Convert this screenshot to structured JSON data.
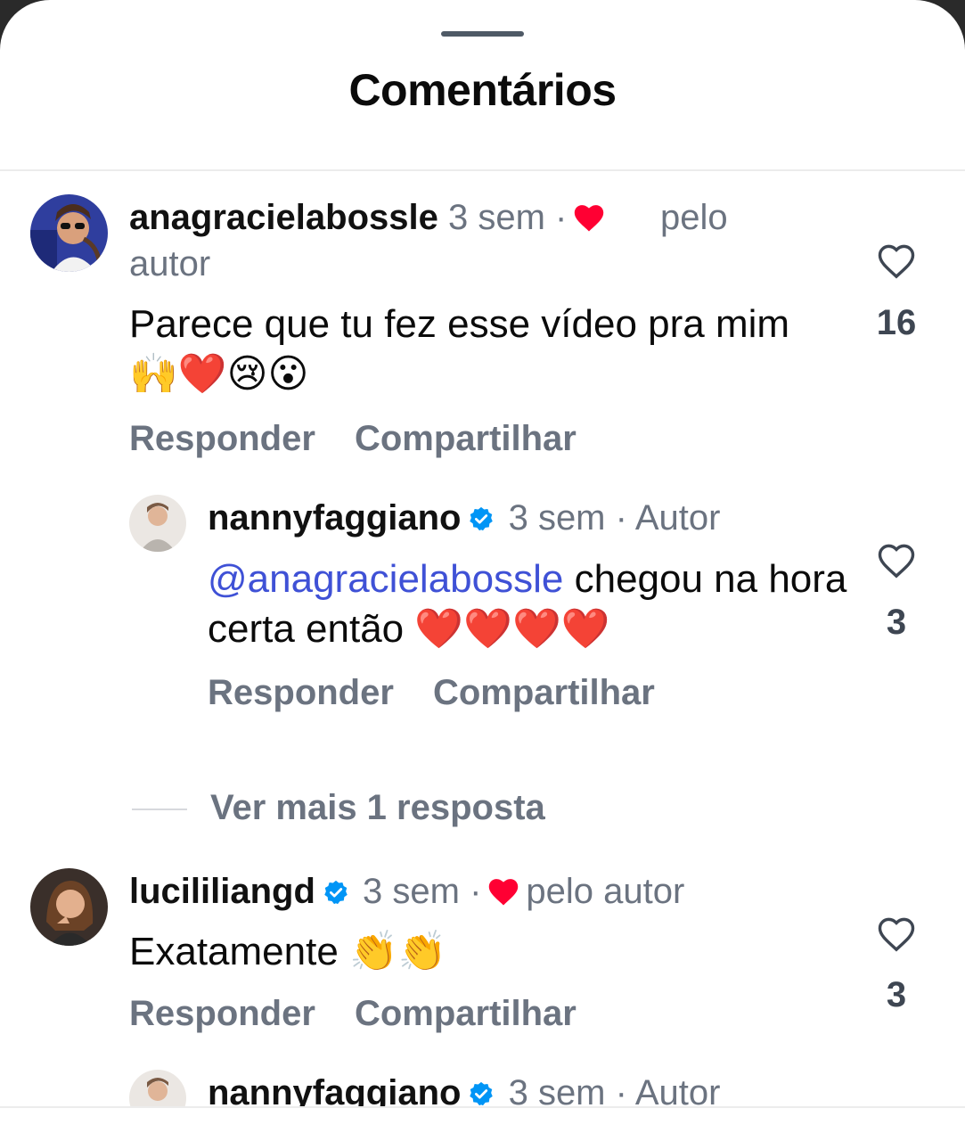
{
  "sheet": {
    "title": "Comentários"
  },
  "comments": [
    {
      "username": "anagracielabossle",
      "time": "3 sem",
      "author_like_label": "pelo autor",
      "text": "Parece que tu fez esse vídeo pra mim",
      "emojis": "🙌❤️😢😮",
      "like_count": "16",
      "reply_label": "Responder",
      "share_label": "Compartilhar"
    },
    {
      "username": "nannyfaggiano",
      "verified": true,
      "time": "3 sem",
      "author_badge": "Autor",
      "mention": "@anagracielabossle",
      "text": "chegou na hora certa então",
      "emojis": "❤️❤️❤️❤️",
      "like_count": "3",
      "reply_label": "Responder",
      "share_label": "Compartilhar"
    },
    {
      "username": "lucililiangd",
      "verified": true,
      "time": "3 sem",
      "author_like_label": "pelo autor",
      "text": "Exatamente",
      "emojis": "👏👏",
      "like_count": "3",
      "reply_label": "Responder",
      "share_label": "Compartilhar"
    },
    {
      "username": "nannyfaggiano",
      "verified": true,
      "time": "3 sem",
      "author_badge": "Autor"
    }
  ],
  "view_more_replies": "Ver mais 1 resposta",
  "colors": {
    "verified_blue": "#0095f6",
    "heart_red": "#ff0033",
    "muted": "#6b7380",
    "mention": "#3f51d6"
  },
  "icons": {
    "like": "heart-outline-icon",
    "verified": "verified-badge-icon",
    "author_liked": "red-heart-icon"
  }
}
